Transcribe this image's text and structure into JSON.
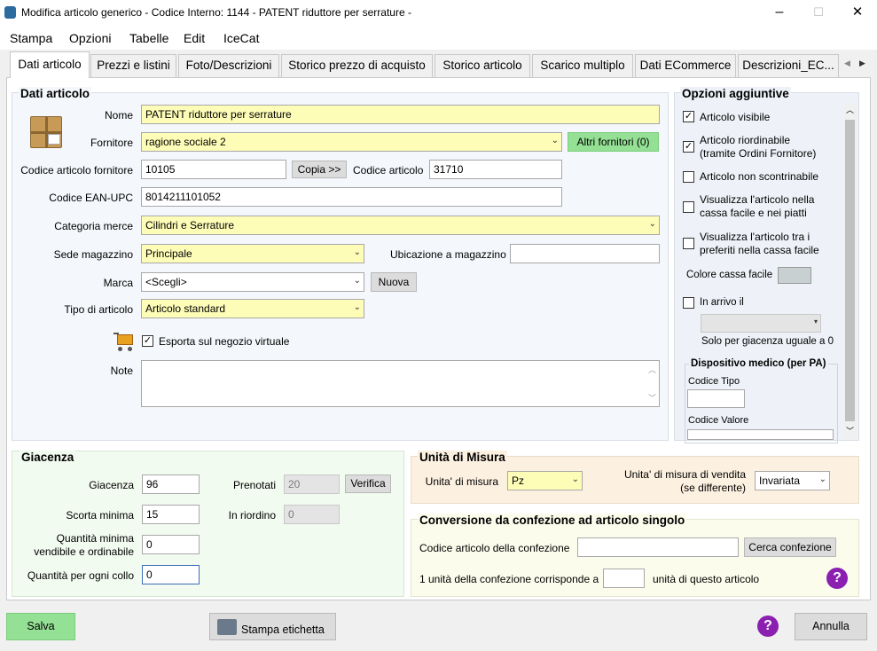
{
  "window": {
    "title": "Modifica articolo generico - Codice Interno: 1144 - PATENT riduttore per serrature -",
    "minimize": "–",
    "maximize": "☐",
    "close": "✕"
  },
  "menu": [
    "Stampa",
    "Opzioni",
    "Tabelle",
    "Edit",
    "IceCat"
  ],
  "tabs": [
    "Dati articolo",
    "Prezzi e listini",
    "Foto/Descrizioni",
    "Storico prezzo di acquisto",
    "Storico articolo",
    "Scarico multiplo",
    "Dati ECommerce",
    "Descrizioni_EC..."
  ],
  "tab_nav": {
    "left": "◀",
    "right": "▶"
  },
  "dati": {
    "title": "Dati articolo",
    "nome_label": "Nome",
    "nome_value": "PATENT riduttore per serrature",
    "fornitore_label": "Fornitore",
    "fornitore_value": "ragione sociale 2",
    "altri_fornitori": "Altri fornitori (0)",
    "cod_forn_label": "Codice articolo fornitore",
    "cod_forn_value": "10105",
    "copia": "Copia >>",
    "cod_art_label": "Codice articolo",
    "cod_art_value": "31710",
    "ean_label": "Codice EAN-UPC",
    "ean_value": "8014211101052",
    "categoria_label": "Categoria merce",
    "categoria_value": "Cilindri e Serrature",
    "sede_label": "Sede magazzino",
    "sede_value": "Principale",
    "ubicazione_label": "Ubicazione a magazzino",
    "ubicazione_value": "",
    "marca_label": "Marca",
    "marca_value": "<Scegli>",
    "nuova": "Nuova",
    "tipo_label": "Tipo di articolo",
    "tipo_value": "Articolo standard",
    "esporta_label": "Esporta sul negozio virtuale",
    "note_label": "Note",
    "note_value": ""
  },
  "opzioni": {
    "title": "Opzioni aggiuntive",
    "visibile": "Articolo visibile",
    "riordinabile": "Articolo riordinabile (tramite Ordini Fornitore)",
    "non_scontrinabile": "Articolo non scontrinabile",
    "cassa_facile": "Visualizza l'articolo nella cassa facile e nei piatti",
    "preferiti": "Visualizza l'articolo tra i preferiti nella cassa facile",
    "colore_label": "Colore cassa facile",
    "in_arrivo": "In arrivo il",
    "solo_giacenza": "Solo per giacenza uguale a 0",
    "dispositivo_title": "Dispositivo medico (per PA)",
    "codice_tipo": "Codice Tipo",
    "codice_valore": "Codice Valore"
  },
  "giacenza": {
    "title": "Giacenza",
    "giacenza_label": "Giacenza",
    "giacenza_value": "96",
    "prenotati_label": "Prenotati",
    "prenotati_value": "20",
    "verifica": "Verifica",
    "scorta_label": "Scorta minima",
    "scorta_value": "15",
    "riordino_label": "In riordino",
    "riordino_value": "0",
    "qmin_label_1": "Quantità minima",
    "qmin_label_2": "vendibile e ordinabile",
    "qmin_value": "0",
    "collo_label": "Quantità per ogni collo",
    "collo_value": "0"
  },
  "unita": {
    "title": "Unità di Misura",
    "misura_label": "Unita' di misura",
    "misura_value": "Pz",
    "vendita_label_1": "Unita' di misura di vendita",
    "vendita_label_2": "(se differente)",
    "vendita_value": "Invariata"
  },
  "conversione": {
    "title": "Conversione da confezione ad articolo singolo",
    "codice_label": "Codice articolo della confezione",
    "codice_value": "",
    "cerca": "Cerca confezione",
    "unita_label": "1 unità della confezione corrisponde a",
    "unita_value": "",
    "unita_suffix": "unità di questo articolo"
  },
  "footer": {
    "salva": "Salva",
    "stampa": "Stampa etichetta",
    "annulla": "Annulla"
  },
  "colors": {
    "yellow_field": "#fefdb8",
    "green_button": "#94e094",
    "help_purple": "#8a1fb0"
  }
}
